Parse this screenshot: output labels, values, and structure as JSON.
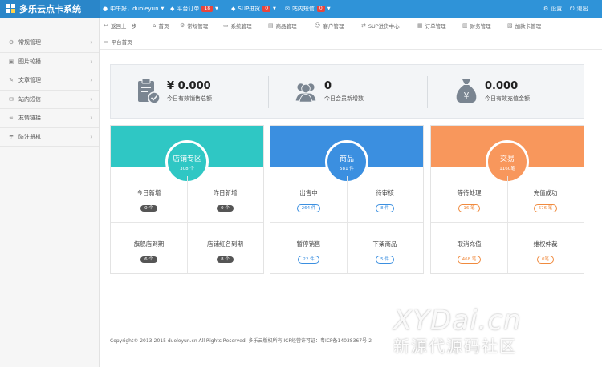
{
  "app": {
    "title": "多乐云点卡系统"
  },
  "topbar": {
    "greeting": "中午好，duoleyun",
    "orders": {
      "label": "平台订单",
      "count": "18"
    },
    "sup": {
      "label": "SUP进货",
      "count": "0"
    },
    "messages": {
      "label": "站内短信",
      "count": "0"
    },
    "settings": "设置",
    "logout": "退出"
  },
  "sidebar": {
    "items": [
      {
        "label": "常规管理",
        "icon": "cog-icon"
      },
      {
        "label": "图片轮播",
        "icon": "image-icon"
      },
      {
        "label": "文章管理",
        "icon": "edit-icon"
      },
      {
        "label": "站内短信",
        "icon": "mail-icon"
      },
      {
        "label": "友情链接",
        "icon": "link-icon"
      },
      {
        "label": "防注册机",
        "icon": "umbrella-icon"
      }
    ]
  },
  "quicknav": {
    "row1": [
      {
        "label": "返回上一步",
        "icon": "back-icon"
      },
      {
        "label": "首页",
        "icon": "home-icon"
      },
      {
        "label": "常规管理",
        "icon": "cog-icon"
      },
      {
        "label": "系统管理",
        "icon": "monitor-icon"
      },
      {
        "label": "商品管理",
        "icon": "grid-icon"
      },
      {
        "label": "客户管理",
        "icon": "user-icon"
      },
      {
        "label": "SUP进货中心",
        "icon": "exchange-icon"
      },
      {
        "label": "订单管理",
        "icon": "order-icon"
      },
      {
        "label": "财务管理",
        "icon": "finance-icon"
      },
      {
        "label": "加款卡管理",
        "icon": "card-icon"
      }
    ],
    "row2": [
      {
        "label": "平台首页",
        "icon": "page-icon"
      }
    ]
  },
  "stats": [
    {
      "value": "¥ 0.000",
      "label": "今日有效销售总额",
      "icon": "clipboard-check-icon"
    },
    {
      "value": "0",
      "label": "今日会员新增数",
      "icon": "users-icon"
    },
    {
      "value": "0.000",
      "label": "今日有效充值金额",
      "icon": "money-bag-icon"
    }
  ],
  "cards": [
    {
      "title": "店铺专区",
      "subtitle": "308 个",
      "color": "#2fc7c4",
      "cells": [
        {
          "label": "今日新增",
          "pill": "0 个",
          "style": "dark"
        },
        {
          "label": "昨日新增",
          "pill": "0 个",
          "style": "dark"
        },
        {
          "label": "旗舰店到期",
          "pill": "6 个",
          "style": "dark"
        },
        {
          "label": "店铺红名到期",
          "pill": "8 个",
          "style": "dark"
        }
      ]
    },
    {
      "title": "商品",
      "subtitle": "581 件",
      "color": "#3b8fe0",
      "cells": [
        {
          "label": "出售中",
          "pill": "264 件",
          "style": "blue"
        },
        {
          "label": "待审核",
          "pill": "8 件",
          "style": "blue"
        },
        {
          "label": "暂停销售",
          "pill": "22 件",
          "style": "blue"
        },
        {
          "label": "下架商品",
          "pill": "5 件",
          "style": "blue"
        }
      ]
    },
    {
      "title": "交易",
      "subtitle": "1160笔",
      "color": "#f8975c",
      "cells": [
        {
          "label": "等待处理",
          "pill": "16 笔",
          "style": "orange"
        },
        {
          "label": "充值成功",
          "pill": "676 笔",
          "style": "orange"
        },
        {
          "label": "取消充值",
          "pill": "468 笔",
          "style": "orange"
        },
        {
          "label": "维权仲裁",
          "pill": "0笔",
          "style": "orange"
        }
      ]
    }
  ],
  "footer": {
    "text": "Copyright© 2013-2015 duoleyun.cn All Rights Reserved. 多乐云版权所有 ICP经营许可证：粤ICP备14038367号-2"
  },
  "watermark": {
    "line1": "XYDai.cn",
    "line2": "新源代源码社区"
  }
}
